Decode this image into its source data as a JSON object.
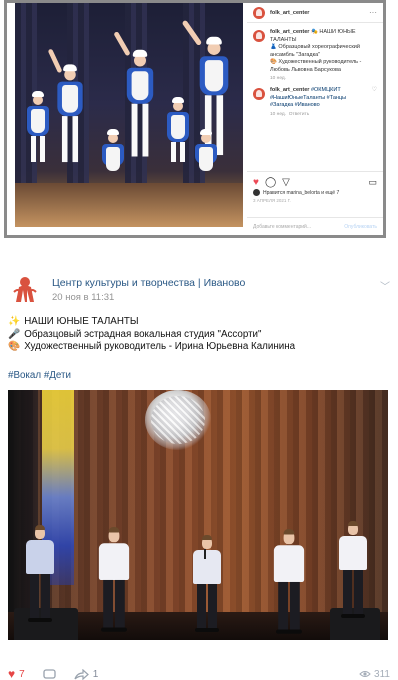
{
  "instagram": {
    "username": "folk_art_center",
    "comment_username": "folk_art_center",
    "caption_line1": "🎭 НАШИ ЮНЫЕ ТАЛАНТЫ",
    "caption_line2": "Образцовый хореографический ансамбль \"Загадка\"",
    "caption_line3": "Художественный руководитель - Любовь Львовна Барсукова",
    "caption_time": "10 нед.",
    "tags_username": "folk_art_center",
    "tags_text": "#ОКМЦКИТ #НашиЮныеТаланты #Танцы #Загадка #Иваново",
    "tags_time": "10 нед.",
    "tags_reply": "Ответить",
    "liked_by": "Нравится marina_belorta и ещё 7",
    "date": "3 АПРЕЛЯ 2021 Г.",
    "add_comment_placeholder": "Добавьте комментарий...",
    "publish_label": "Опубликовать"
  },
  "vk": {
    "group_name": "Центр культуры и творчества | Иваново",
    "post_date": "20 ноя в 11:31",
    "line1": "НАШИ ЮНЫЕ ТАЛАНТЫ",
    "line2": "Образцовый эстрадная вокальная студия \"Ассорти\"",
    "line3": "Художественный руководитель - Ирина Юрьевна Калинина",
    "hashtags": "#Вокал #Дети",
    "likes_count": "7",
    "shares_count": "1",
    "views_count": "311"
  },
  "colors": {
    "vk_link": "#2a5885",
    "vk_like": "#e64646",
    "ig_heart": "#ed4956",
    "logo_red": "#d9523f"
  }
}
